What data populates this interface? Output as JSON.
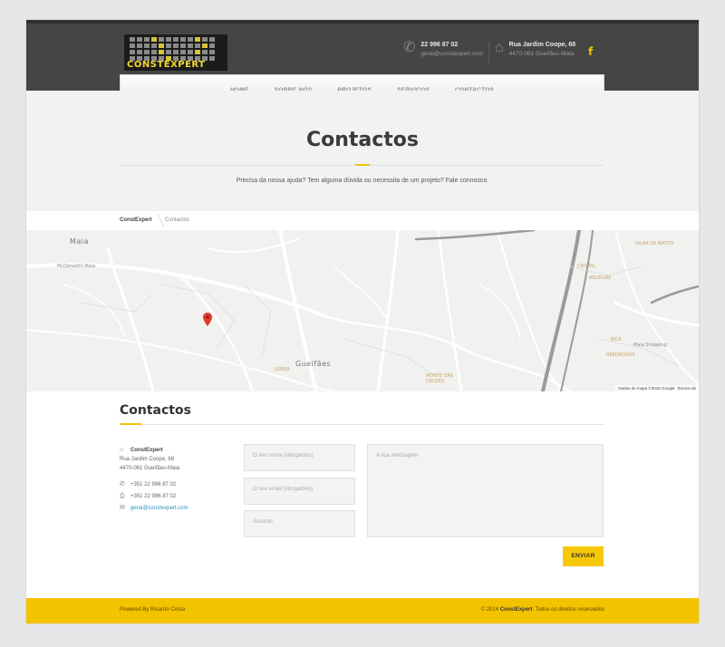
{
  "header": {
    "logo_text": "CONSTEXPERT",
    "phone": "22 996 87 02",
    "email": "geral@constexpert.com",
    "address_line1": "Rua Jardim Coope, 68",
    "address_line2": "4470-061 Gueifães-Maia",
    "facebook_glyph": "f"
  },
  "nav": {
    "items": [
      "HOME",
      "SOBRE NÓS",
      "PROJETOS",
      "SERVIÇOS",
      "CONTACTOS"
    ]
  },
  "page": {
    "title": "Contactos",
    "subtitle": "Precisa da nossa ajuda? Tem alguma dúvida ou necessita de um projeto? Fale connosco."
  },
  "breadcrumb": {
    "home": "ConstExpert",
    "current": "Contactos"
  },
  "map": {
    "labels": [
      "Maia",
      "Gueifães",
      "VILAR DE MATOS",
      "CRISTAL",
      "ARDEGÃE",
      "BICA",
      "REBORDÃOS",
      "MONTE DAS CRUZES",
      "IGREJA",
      "Maia Shopping",
      "McDonald's Maia"
    ],
    "credit_data": "Dados do mapa ©2015 Google",
    "credit_terms": "Termos de"
  },
  "contact": {
    "heading": "Contactos",
    "company": "ConstExpert",
    "street": "Rua Jardim Coope, 68",
    "city": "4470-061 Gueifães-Maia",
    "phone": "+351 22 996 87 02",
    "fax": "+351 22 996 87 02",
    "email": "geral@constexpert.com"
  },
  "form": {
    "name_placeholder": "O seu nome (obrigatório)",
    "email_placeholder": "O seu email (obrigatório)",
    "subject_placeholder": "Assunto",
    "message_placeholder": "A sua mensagem",
    "submit_label": "ENVIAR"
  },
  "footer": {
    "left": "Powered By Ricardo Costa",
    "right_prefix": "© 2014",
    "right_brand": "ConstExpert",
    "right_suffix": ". Todos os direitos reservados"
  },
  "colors": {
    "accent": "#f4c300",
    "header_bg": "#444545",
    "link": "#2a8fc1"
  },
  "icons": [
    "phone-icon",
    "home-icon",
    "facebook-icon",
    "map-marker-icon",
    "envelope-icon",
    "fax-icon"
  ]
}
